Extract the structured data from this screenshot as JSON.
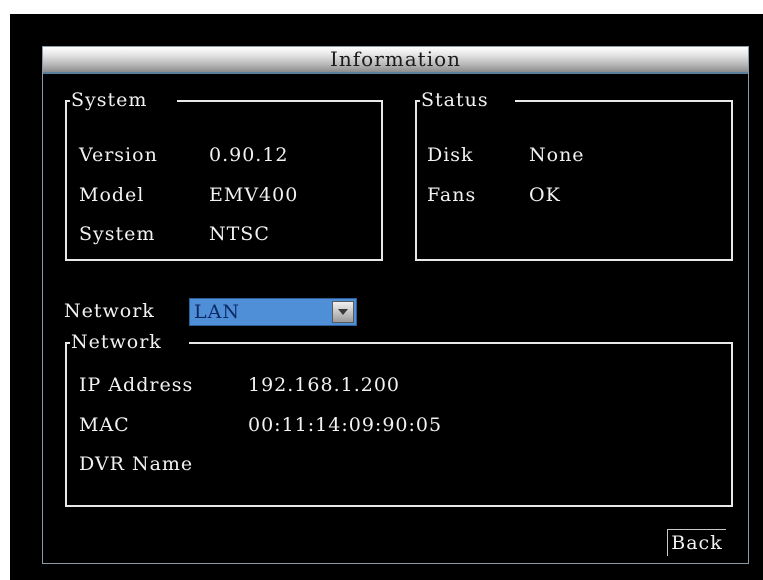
{
  "dialog": {
    "title": "Information"
  },
  "system": {
    "title": "System",
    "rows": [
      {
        "label": "Version",
        "value": "0.90.12"
      },
      {
        "label": "Model",
        "value": "EMV400"
      },
      {
        "label": "System",
        "value": "NTSC"
      }
    ]
  },
  "status": {
    "title": "Status",
    "rows": [
      {
        "label": "Disk",
        "value": "None"
      },
      {
        "label": "Fans",
        "value": "OK"
      }
    ]
  },
  "network_select": {
    "label": "Network",
    "value": "LAN"
  },
  "network": {
    "title": "Network",
    "rows": [
      {
        "label": "IP Address",
        "value": "192.168.1.200"
      },
      {
        "label": "MAC",
        "value": "00:11:14:09:90:05"
      },
      {
        "label": "DVR Name",
        "value": ""
      }
    ]
  },
  "buttons": {
    "back": "Back"
  },
  "colors": {
    "background": "#000000",
    "text": "#f2f2f2",
    "dropdown": "#4f8fd8",
    "border": "#8a9aa6"
  }
}
